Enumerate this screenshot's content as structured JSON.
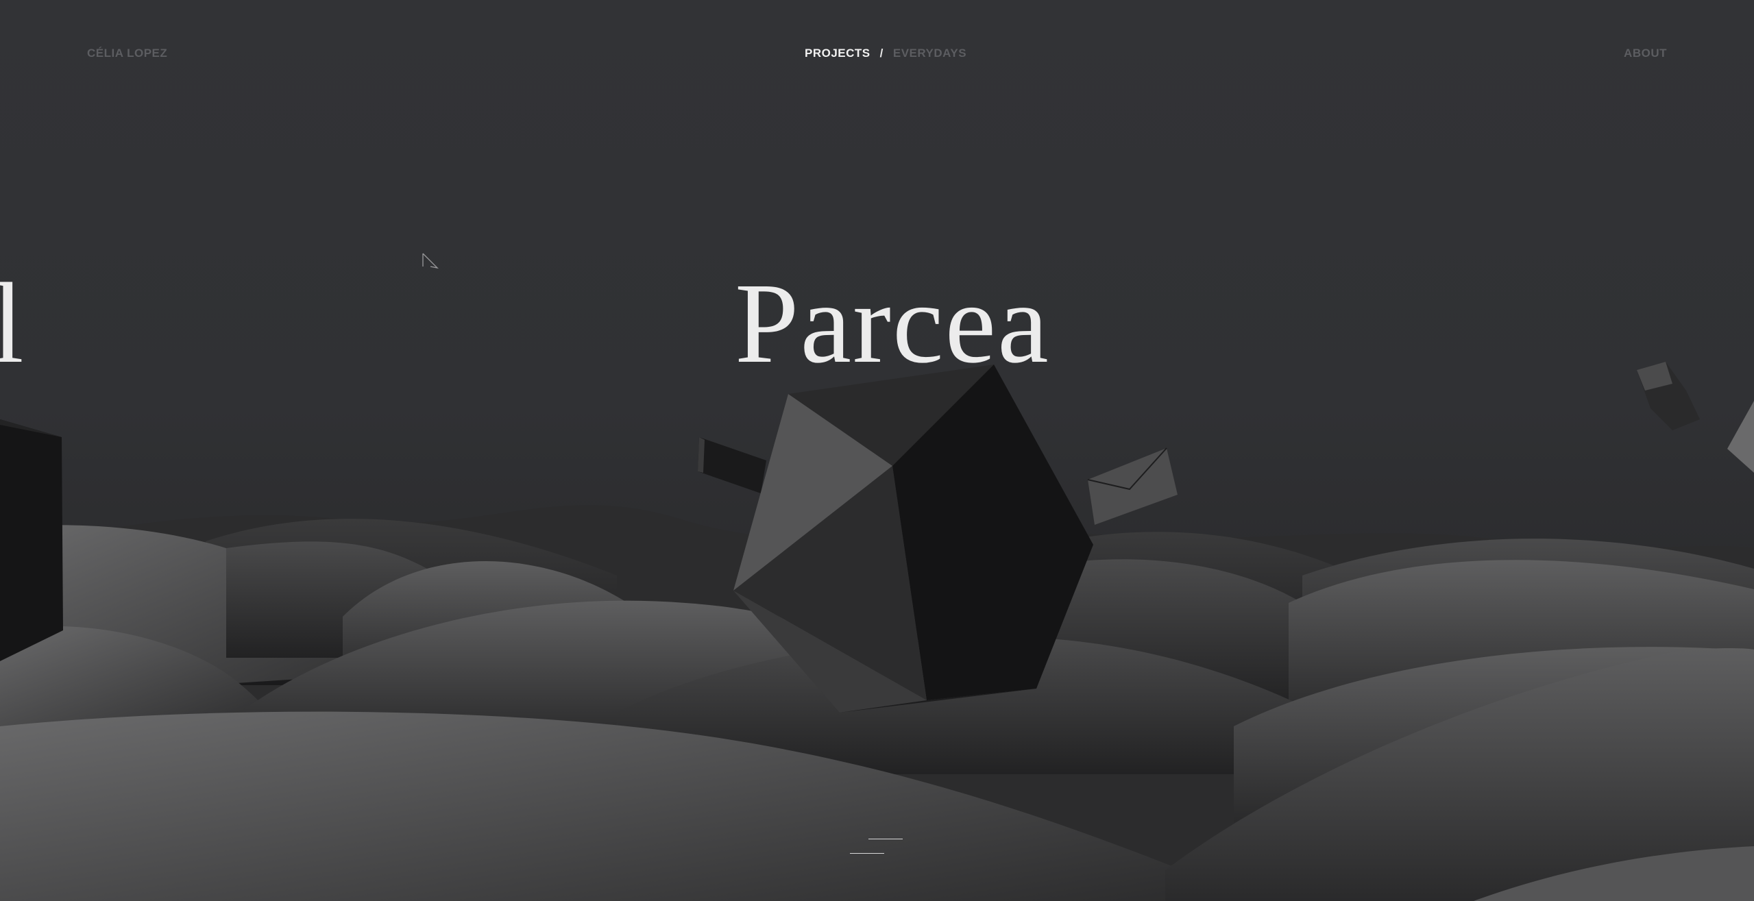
{
  "header": {
    "brand": "CÉLIA LOPEZ",
    "nav": {
      "projects_label": "PROJECTS",
      "separator": "/",
      "everydays_label": "EVERYDAYS"
    },
    "about_label": "ABOUT"
  },
  "slider": {
    "current_title": "Parcea",
    "previous_title_fragment": "l"
  },
  "icons": {
    "cursor": "arrow-cursor-icon",
    "pagination": "slide-indicator-icon"
  },
  "colors": {
    "background": "#333437",
    "active_nav": "#f2f2f2",
    "inactive_nav": "#5c5d61",
    "title": "#ececec"
  }
}
